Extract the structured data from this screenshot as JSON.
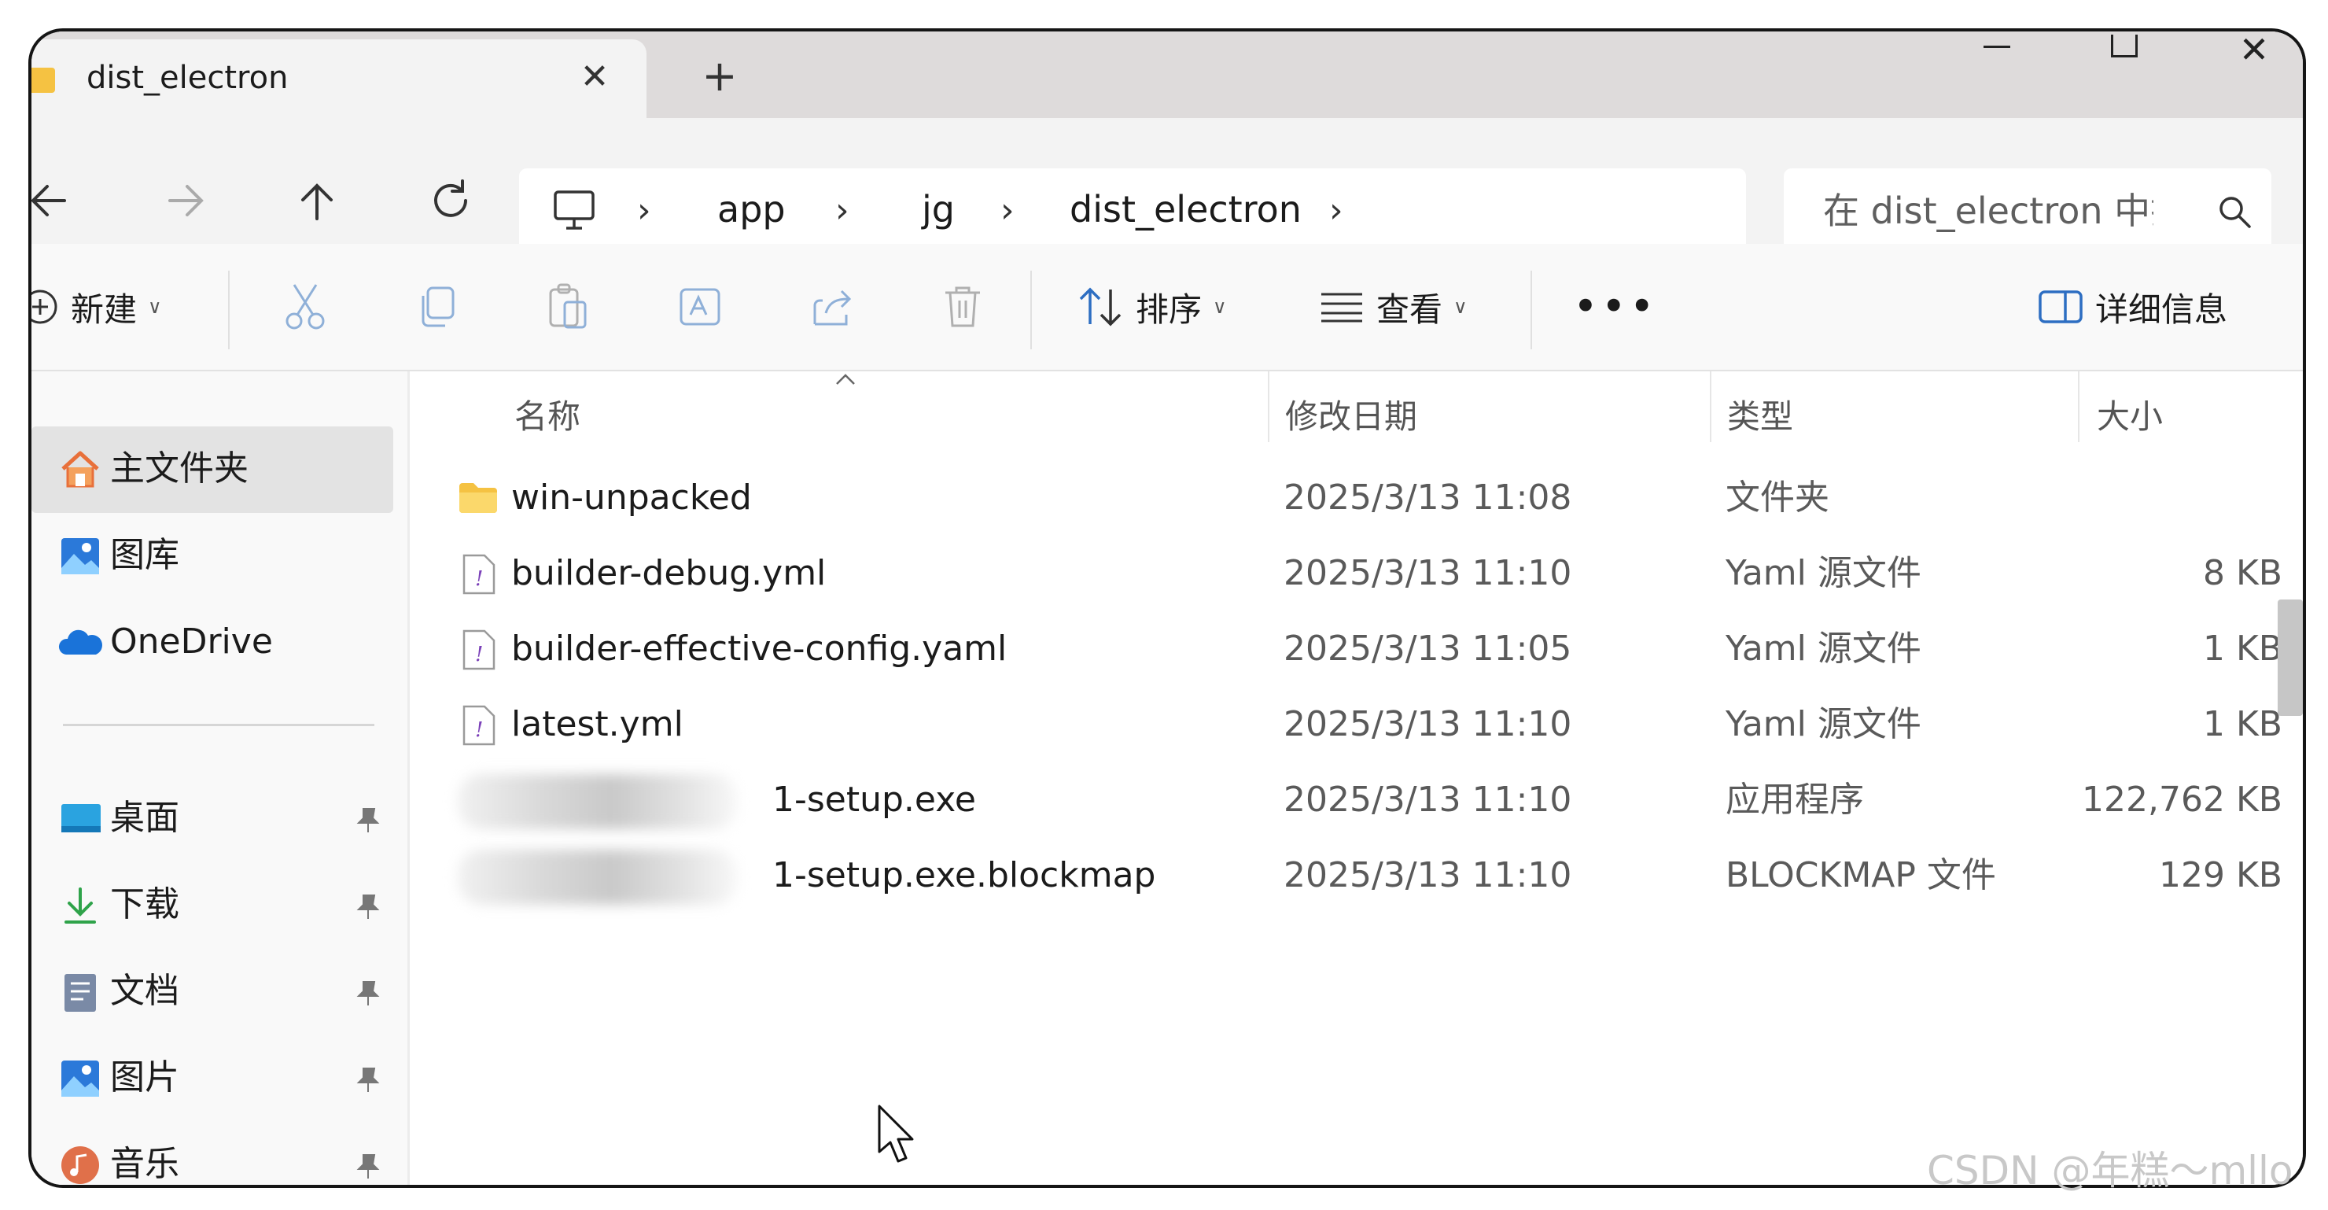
{
  "window": {
    "tab_title": "dist_electron",
    "tab_close": "✕",
    "new_tab": "+"
  },
  "address": {
    "breadcrumb": [
      {
        "label": "app"
      },
      {
        "label": "jg"
      },
      {
        "label": "dist_electron"
      }
    ],
    "search_placeholder": "在 dist_electron 中搜索"
  },
  "commands": {
    "new_label": "新建",
    "sort_label": "排序",
    "view_label": "查看",
    "more_label": "•••",
    "details_label": "详细信息"
  },
  "sidebar": {
    "top_items": [
      {
        "label": "主文件夹",
        "icon": "home-icon",
        "selected": true
      },
      {
        "label": "图库",
        "icon": "gallery-icon"
      },
      {
        "label": "OneDrive",
        "icon": "onedrive-icon"
      }
    ],
    "pinned_items": [
      {
        "label": "桌面",
        "icon": "desktop-icon"
      },
      {
        "label": "下载",
        "icon": "download-icon"
      },
      {
        "label": "文档",
        "icon": "documents-icon"
      },
      {
        "label": "图片",
        "icon": "pictures-icon"
      },
      {
        "label": "音乐",
        "icon": "music-icon"
      }
    ]
  },
  "files": {
    "columns": {
      "name": "名称",
      "modified": "修改日期",
      "type": "类型",
      "size": "大小"
    },
    "rows": [
      {
        "name": "win-unpacked",
        "modified": "2025/3/13 11:08",
        "type": "文件夹",
        "size": "",
        "icon": "folder-icon"
      },
      {
        "name": "builder-debug.yml",
        "modified": "2025/3/13 11:10",
        "type": "Yaml 源文件",
        "size": "8 KB",
        "icon": "yaml-file-icon"
      },
      {
        "name": "builder-effective-config.yaml",
        "modified": "2025/3/13 11:05",
        "type": "Yaml 源文件",
        "size": "1 KB",
        "icon": "yaml-file-icon"
      },
      {
        "name": "latest.yml",
        "modified": "2025/3/13 11:10",
        "type": "Yaml 源文件",
        "size": "1 KB",
        "icon": "yaml-file-icon"
      },
      {
        "name": "1-setup.exe",
        "modified": "2025/3/13 11:10",
        "type": "应用程序",
        "size": "122,762 KB",
        "icon": "exe-file-icon",
        "blurred_prefix": true
      },
      {
        "name": "1-setup.exe.blockmap",
        "modified": "2025/3/13 11:10",
        "type": "BLOCKMAP 文件",
        "size": "129 KB",
        "icon": "blockmap-file-icon",
        "blurred_prefix": true
      }
    ]
  },
  "watermark": "CSDN @年糕～mllo"
}
